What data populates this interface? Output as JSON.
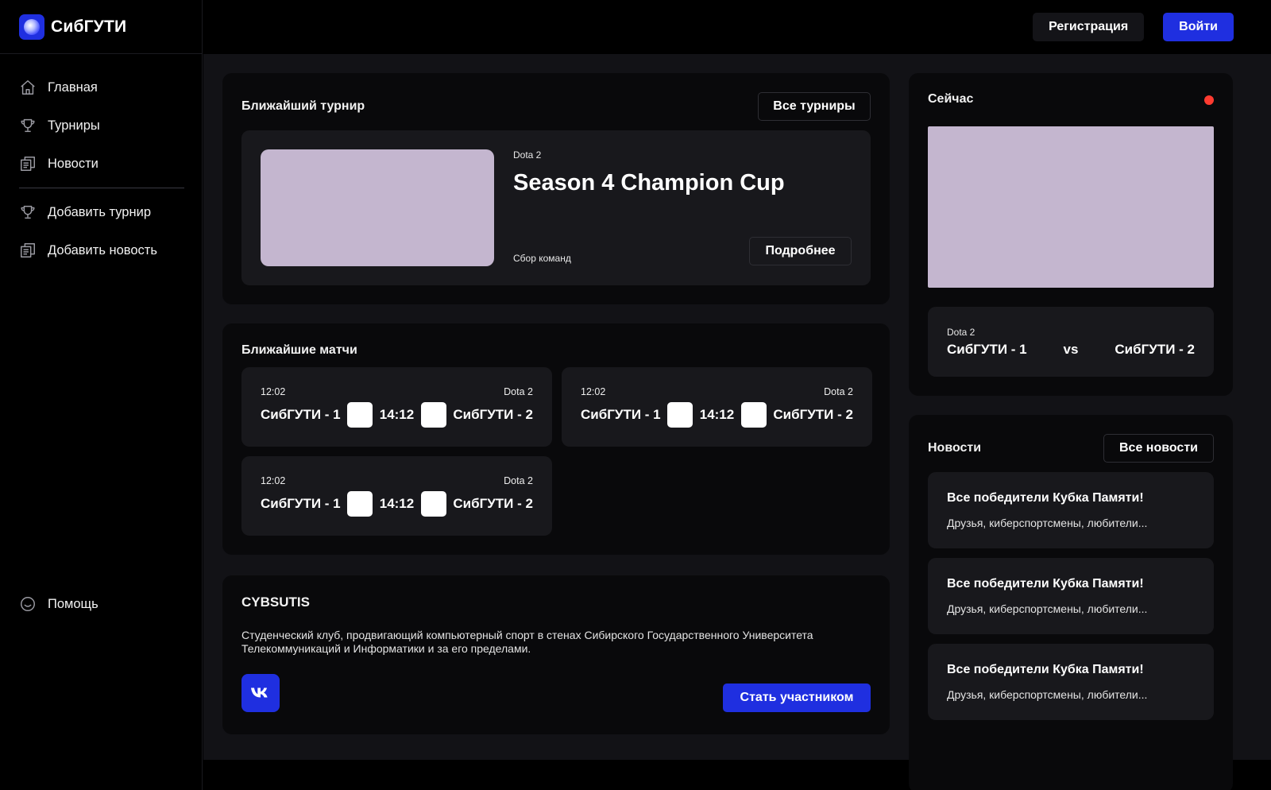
{
  "app": {
    "name": "СибГУТИ"
  },
  "sidebar": {
    "items": [
      {
        "label": "Главная",
        "icon": "home-icon"
      },
      {
        "label": "Турниры",
        "icon": "trophy-icon"
      },
      {
        "label": "Новости",
        "icon": "news-icon"
      }
    ],
    "admin_items": [
      {
        "label": "Добавить турнир",
        "icon": "trophy-icon"
      },
      {
        "label": "Добавить новость",
        "icon": "news-icon"
      }
    ],
    "help": {
      "label": "Помощь",
      "icon": "help-icon"
    }
  },
  "header": {
    "register_label": "Регистрация",
    "login_label": "Войти"
  },
  "tournament": {
    "section_title": "Ближайший турнир",
    "all_label": "Все турниры",
    "game": "Dota 2",
    "name": "Season 4 Champion Cup",
    "status": "Сбор команд",
    "details_label": "Подробнее"
  },
  "matches": {
    "section_title": "Ближайшие матчи",
    "items": [
      {
        "time": "12:02",
        "game": "Dota 2",
        "team1": "СибГУТИ - 1",
        "score_time": "14:12",
        "team2": "СибГУТИ - 2"
      },
      {
        "time": "12:02",
        "game": "Dota 2",
        "team1": "СибГУТИ - 1",
        "score_time": "14:12",
        "team2": "СибГУТИ - 2"
      },
      {
        "time": "12:02",
        "game": "Dota 2",
        "team1": "СибГУТИ - 1",
        "score_time": "14:12",
        "team2": "СибГУТИ - 2"
      }
    ]
  },
  "club": {
    "title": "CYBSUTIS",
    "description_line1": "Студенческий клуб, продвигающий компьютерный спорт в стенах Сибирского Государственного Университета",
    "description_line2": "Телекоммуникаций и Информатики и за его пределами.",
    "vk_icon": "vk-icon",
    "join_label": "Стать участником"
  },
  "live": {
    "title": "Сейчас",
    "indicator_color": "#ff3b30",
    "game": "Dota 2",
    "team1": "СибГУТИ - 1",
    "vs": "vs",
    "team2": "СибГУТИ - 2"
  },
  "news": {
    "section_title": "Новости",
    "all_label": "Все новости",
    "items": [
      {
        "title": "Все победители Кубка Памяти!",
        "excerpt": "Друзья, киберспортсмены, любители..."
      },
      {
        "title": "Все победители Кубка Памяти!",
        "excerpt": "Друзья, киберспортсмены, любители..."
      },
      {
        "title": "Все победители Кубка Памяти!",
        "excerpt": "Друзья, киберспортсмены, любители..."
      }
    ]
  },
  "colors": {
    "accent": "#1f2fe0",
    "placeholder": "#c4b6cf",
    "card": "#09090b",
    "inner_card": "#18181c"
  }
}
